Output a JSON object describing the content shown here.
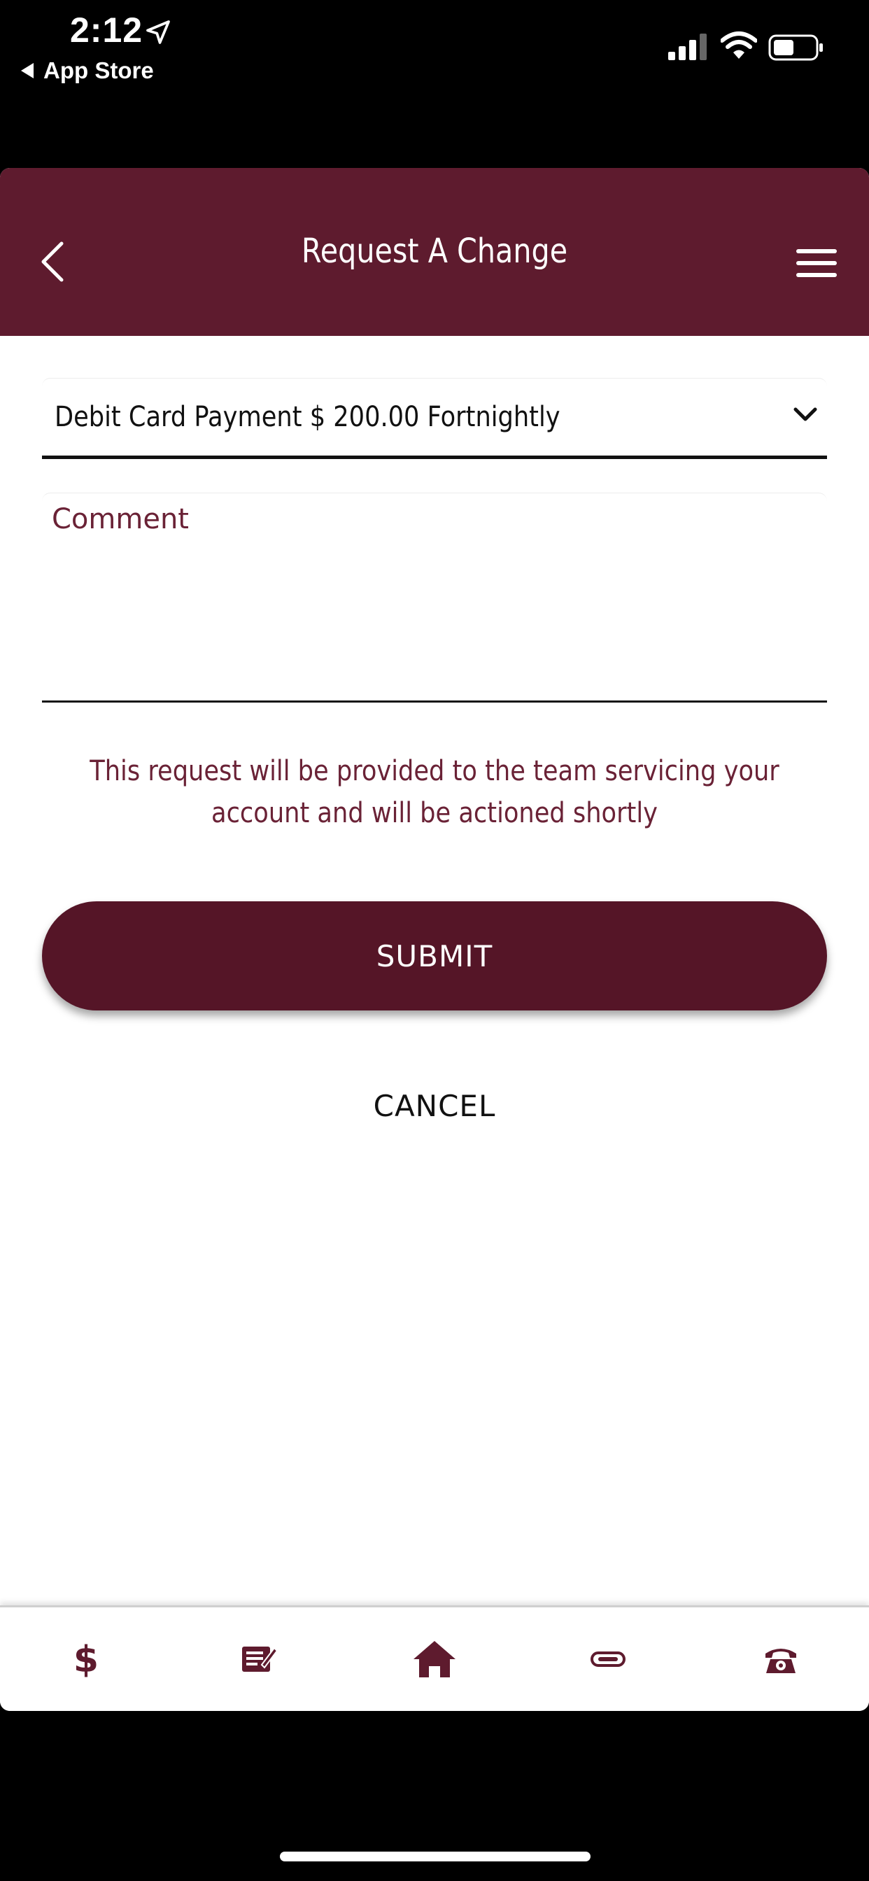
{
  "status_bar": {
    "time": "2:12",
    "back_label": "App Store"
  },
  "header": {
    "title": "Request A Change"
  },
  "form": {
    "dropdown_value": "Debit Card Payment $ 200.00 Fortnightly",
    "comment_placeholder": "Comment",
    "notice": "This request will be provided to the team servicing your account and will be actioned shortly",
    "submit_label": "SUBMIT",
    "cancel_label": "CANCEL"
  },
  "bottom_nav": {
    "items": [
      {
        "icon": "dollar-icon"
      },
      {
        "icon": "statement-icon"
      },
      {
        "icon": "home-icon"
      },
      {
        "icon": "link-icon"
      },
      {
        "icon": "phone-icon"
      }
    ]
  },
  "colors": {
    "brand": "#5e1b2e",
    "button": "#551527"
  }
}
